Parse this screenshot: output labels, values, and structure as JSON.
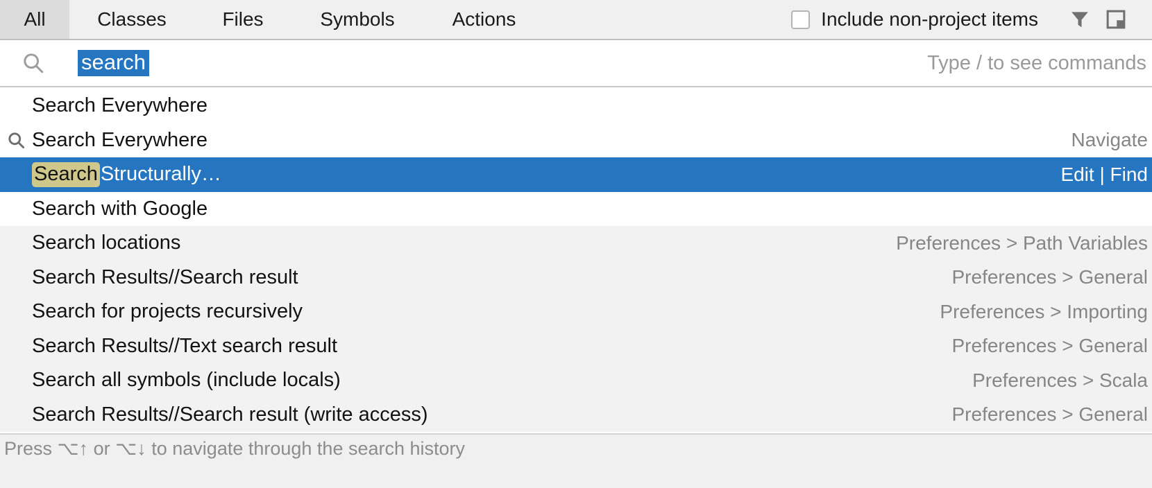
{
  "tabs": [
    {
      "label": "All",
      "selected": true
    },
    {
      "label": "Classes",
      "selected": false
    },
    {
      "label": "Files",
      "selected": false
    },
    {
      "label": "Symbols",
      "selected": false
    },
    {
      "label": "Actions",
      "selected": false
    }
  ],
  "header": {
    "include_non_project_label": "Include non-project items",
    "include_non_project_checked": false,
    "filter_icon": "filter-funnel-icon",
    "pin_icon": "pin-window-icon"
  },
  "search": {
    "icon": "magnifier-icon",
    "value": "search",
    "value_selected": true,
    "hint": "Type / to see commands"
  },
  "results": [
    {
      "icon": "",
      "title_prefix": "",
      "title_match": "",
      "title": "Search Everywhere",
      "right": "",
      "group": "top",
      "selected": false
    },
    {
      "icon": "magnifier-icon",
      "title_prefix": "",
      "title_match": "",
      "title": "Search Everywhere",
      "right": "Navigate",
      "group": "top",
      "selected": false
    },
    {
      "icon": "",
      "title_prefix": "",
      "title_match": "Search",
      "title": " Structurally…",
      "right": "Edit | Find",
      "group": "top",
      "selected": true
    },
    {
      "icon": "",
      "title_prefix": "",
      "title_match": "",
      "title": "Search with Google",
      "right": "",
      "group": "top",
      "selected": false
    },
    {
      "icon": "",
      "title_prefix": "",
      "title_match": "",
      "title": "Search locations",
      "right": "Preferences > Path Variables",
      "group": "bottom",
      "selected": false
    },
    {
      "icon": "",
      "title_prefix": "",
      "title_match": "",
      "title": "Search Results//Search result",
      "right": "Preferences > General",
      "group": "bottom",
      "selected": false
    },
    {
      "icon": "",
      "title_prefix": "",
      "title_match": "",
      "title": "Search for projects recursively",
      "right": "Preferences > Importing",
      "group": "bottom",
      "selected": false
    },
    {
      "icon": "",
      "title_prefix": "",
      "title_match": "",
      "title": "Search Results//Text search result",
      "right": "Preferences > General",
      "group": "bottom",
      "selected": false
    },
    {
      "icon": "",
      "title_prefix": "",
      "title_match": "",
      "title": "Search all symbols (include locals)",
      "right": "Preferences > Scala",
      "group": "bottom",
      "selected": false
    },
    {
      "icon": "",
      "title_prefix": "",
      "title_match": "",
      "title": "Search Results//Search result (write access)",
      "right": "Preferences > General",
      "group": "bottom",
      "selected": false
    }
  ],
  "status": {
    "text": "Press ⌥↑ or ⌥↓ to navigate through the search history"
  },
  "colors": {
    "selection_blue": "#2575c0",
    "match_highlight": "#cfc88a",
    "header_bg": "#f0f0f0",
    "tab_selected_bg": "#dcdcdc",
    "alt_row_bg": "#f2f2f2",
    "secondary_text": "#868686"
  }
}
